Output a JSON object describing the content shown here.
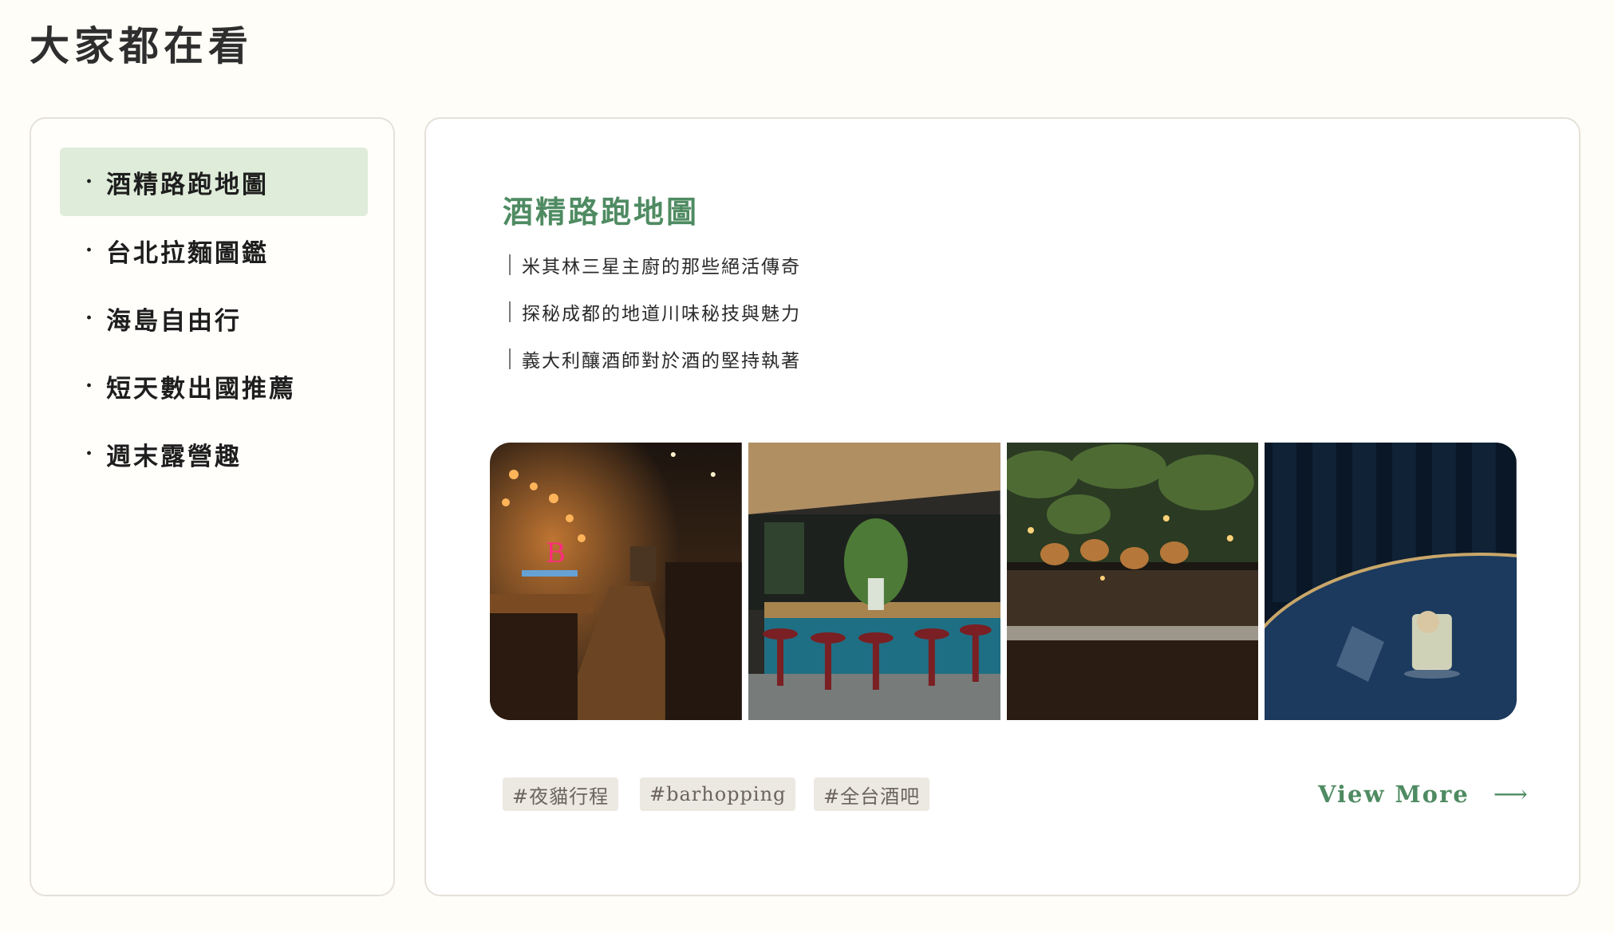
{
  "page": {
    "title": "大家都在看"
  },
  "sidebar": {
    "bullet": "·",
    "items": [
      {
        "label": "酒精路跑地圖",
        "active": true
      },
      {
        "label": "台北拉麵圖鑑",
        "active": false
      },
      {
        "label": "海島自由行",
        "active": false
      },
      {
        "label": "短天數出國推薦",
        "active": false
      },
      {
        "label": "週末露營趣",
        "active": false
      }
    ]
  },
  "feature": {
    "title": "酒精路跑地圖",
    "articles": [
      "米其林三星主廚的那些絕活傳奇",
      "探秘成都的地道川味秘技與魅力",
      "義大利釀酒師對於酒的堅持執著"
    ],
    "tags": [
      "#夜貓行程",
      "#barhopping",
      "#全台酒吧"
    ],
    "view_more": "View More",
    "view_more_icon": "arrow-right-icon"
  },
  "colors": {
    "accent": "#4f8b62",
    "active_bg": "#deecd9",
    "page_bg": "#fffdf7",
    "tag_bg": "#ece8e2"
  }
}
